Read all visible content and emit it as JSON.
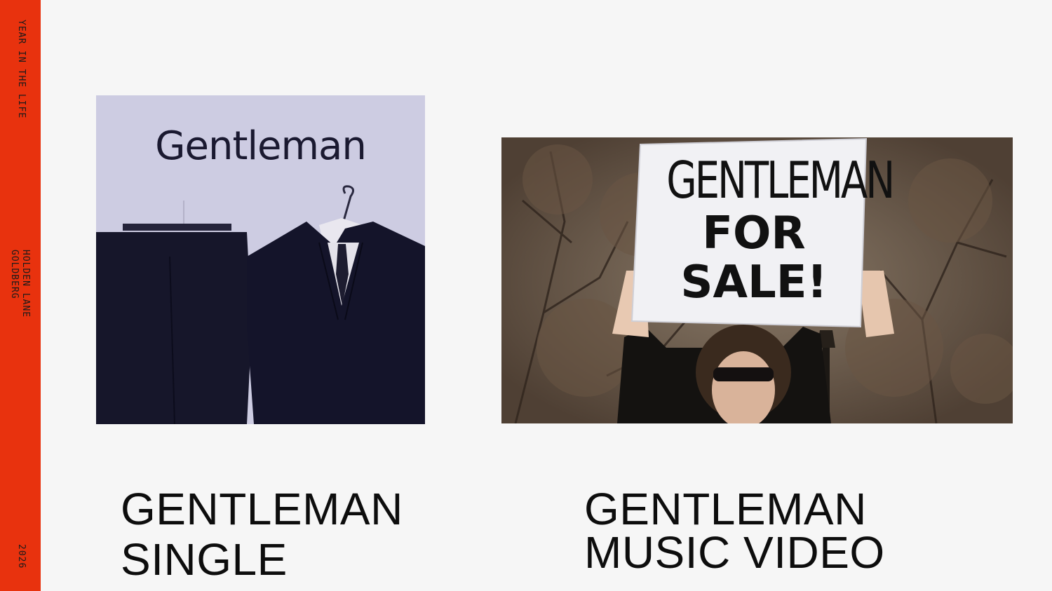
{
  "sidebar": {
    "top_label": "YEAR IN THE LIFE",
    "mid_label_line1": "HOLDEN LANE",
    "mid_label_line2": "GOLDBERG",
    "bottom_label": "2026",
    "color": "#e8320e"
  },
  "single": {
    "art_title": "Gentleman",
    "caption_line1": "GENTLEMAN",
    "caption_line2": "SINGLE"
  },
  "video": {
    "sign_line1": "GENTLEMAN",
    "sign_line2": "FOR",
    "sign_line3": "SALE!",
    "caption_line1": "GENTLEMAN",
    "caption_line2": "MUSIC VIDEO"
  }
}
